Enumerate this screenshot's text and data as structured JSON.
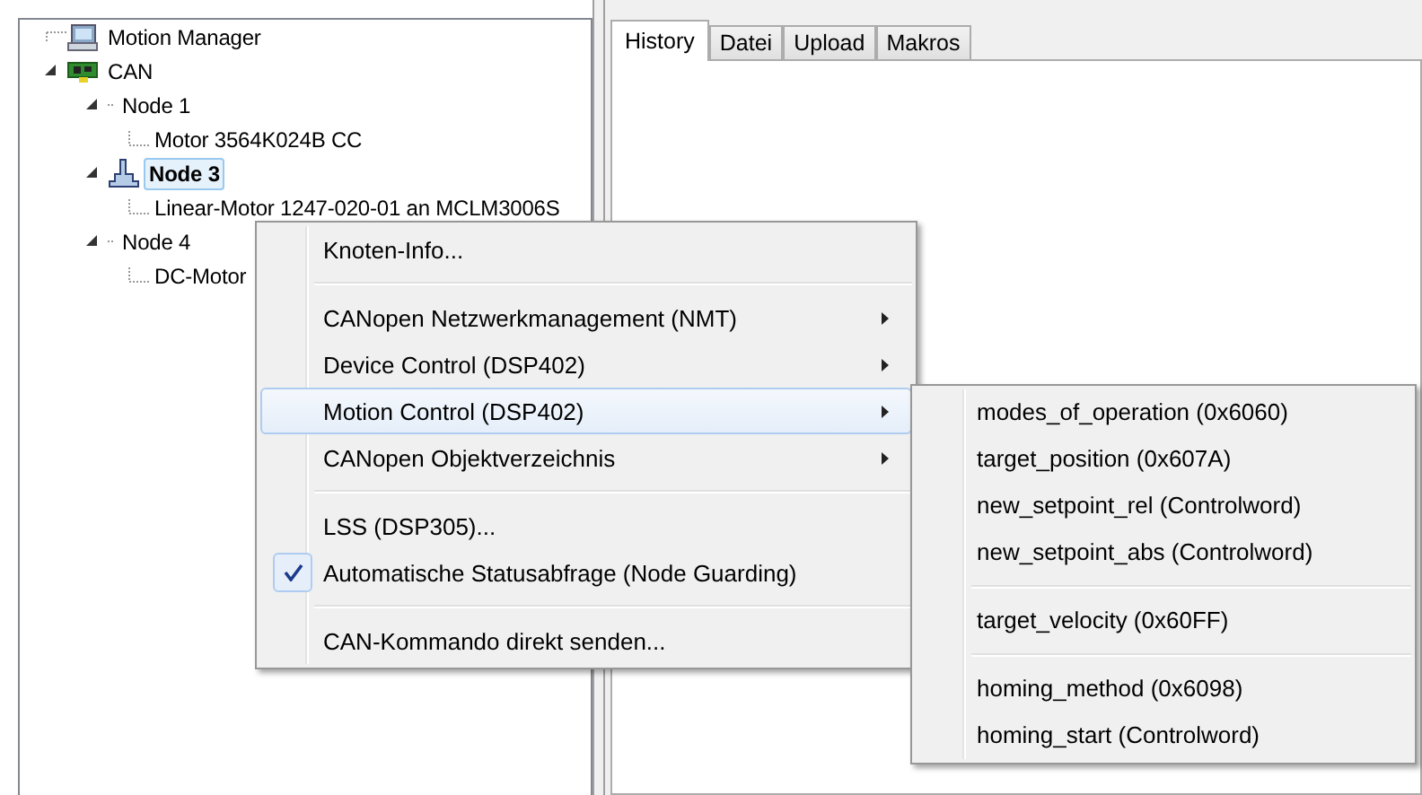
{
  "tree": [
    {
      "label": "Motion Manager",
      "kind": "computer",
      "selected": false,
      "expanded": false
    },
    {
      "label": "CAN",
      "kind": "bus",
      "selected": false,
      "expanded": true,
      "children": [
        {
          "label": "Node 1",
          "kind": "plain",
          "selected": false,
          "expanded": true,
          "children": [
            {
              "label": "Motor 3564K024B CC",
              "kind": "leaf",
              "selected": false,
              "expanded": false
            }
          ]
        },
        {
          "label": "Node 3",
          "kind": "device",
          "selected": true,
          "expanded": true,
          "children": [
            {
              "label": "Linear-Motor 1247-020-01 an MCLM3006S",
              "kind": "leaf",
              "selected": false,
              "expanded": false
            }
          ]
        },
        {
          "label": "Node 4",
          "kind": "plain",
          "selected": false,
          "expanded": true,
          "children": [
            {
              "label": "DC-Motor",
              "kind": "leaf",
              "selected": false,
              "expanded": false
            }
          ]
        }
      ]
    }
  ],
  "tabs": [
    {
      "label": "History",
      "selected": true
    },
    {
      "label": "Datei",
      "selected": false
    },
    {
      "label": "Upload",
      "selected": false
    },
    {
      "label": "Makros",
      "selected": false
    }
  ],
  "context_menu": [
    {
      "kind": "item",
      "label": "Knoten-Info...",
      "submenu": false,
      "selected": false,
      "checked": false
    },
    {
      "kind": "separator"
    },
    {
      "kind": "item",
      "label": "CANopen Netzwerkmanagement (NMT)",
      "submenu": true,
      "selected": false,
      "checked": false
    },
    {
      "kind": "item",
      "label": "Device Control (DSP402)",
      "submenu": true,
      "selected": false,
      "checked": false
    },
    {
      "kind": "item",
      "label": "Motion Control (DSP402)",
      "submenu": true,
      "selected": true,
      "checked": false
    },
    {
      "kind": "item",
      "label": "CANopen Objektverzeichnis",
      "submenu": true,
      "selected": false,
      "checked": false
    },
    {
      "kind": "separator"
    },
    {
      "kind": "item",
      "label": "LSS (DSP305)...",
      "submenu": false,
      "selected": false,
      "checked": false
    },
    {
      "kind": "item",
      "label": "Automatische Statusabfrage (Node Guarding)",
      "submenu": false,
      "selected": false,
      "checked": true
    },
    {
      "kind": "separator"
    },
    {
      "kind": "item",
      "label": "CAN-Kommando direkt senden...",
      "submenu": false,
      "selected": false,
      "checked": false
    }
  ],
  "submenu": [
    {
      "kind": "item",
      "label": "modes_of_operation (0x6060)"
    },
    {
      "kind": "item",
      "label": "target_position (0x607A)"
    },
    {
      "kind": "item",
      "label": "new_setpoint_rel (Controlword)"
    },
    {
      "kind": "item",
      "label": "new_setpoint_abs (Controlword)"
    },
    {
      "kind": "separator"
    },
    {
      "kind": "item",
      "label": "target_velocity (0x60FF)"
    },
    {
      "kind": "separator"
    },
    {
      "kind": "item",
      "label": "homing_method (0x6098)"
    },
    {
      "kind": "item",
      "label": "homing_start (Controlword)"
    }
  ]
}
